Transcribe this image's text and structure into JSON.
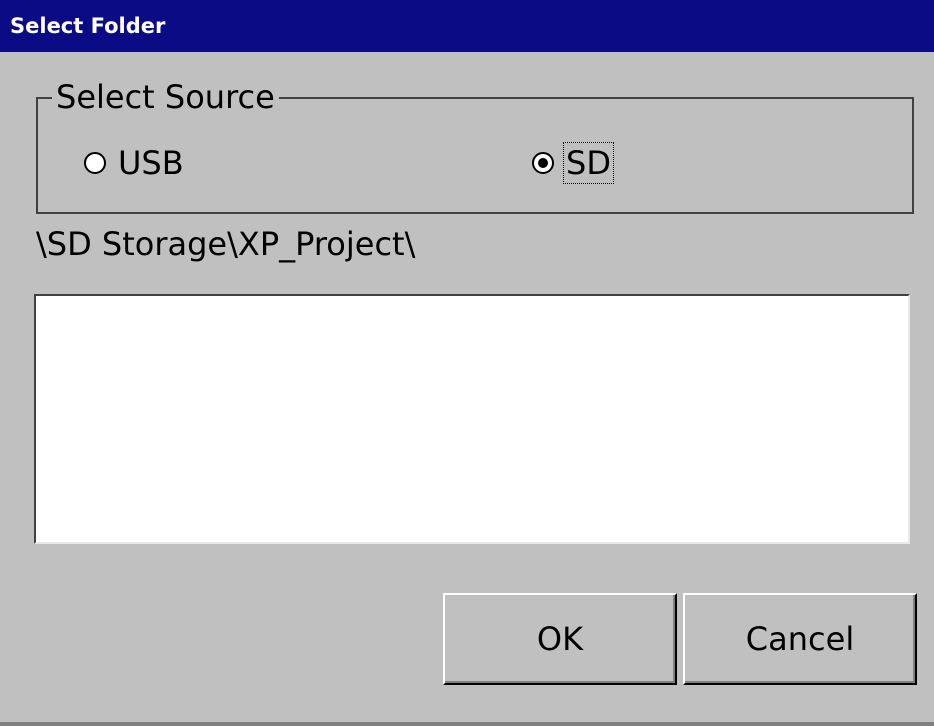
{
  "window": {
    "title": "Select Folder"
  },
  "source_group": {
    "label": "Select Source",
    "options": [
      {
        "label": "USB",
        "checked": false
      },
      {
        "label": "SD",
        "checked": true
      }
    ]
  },
  "current_path": "\\SD Storage\\XP_Project\\",
  "folder_list": {
    "items": []
  },
  "buttons": {
    "ok_label": "OK",
    "cancel_label": "Cancel"
  },
  "colors": {
    "titlebar_bg": "#0b0b86",
    "titlebar_text": "#ffffff",
    "window_bg": "#c0c0c0",
    "list_bg": "#ffffff"
  }
}
